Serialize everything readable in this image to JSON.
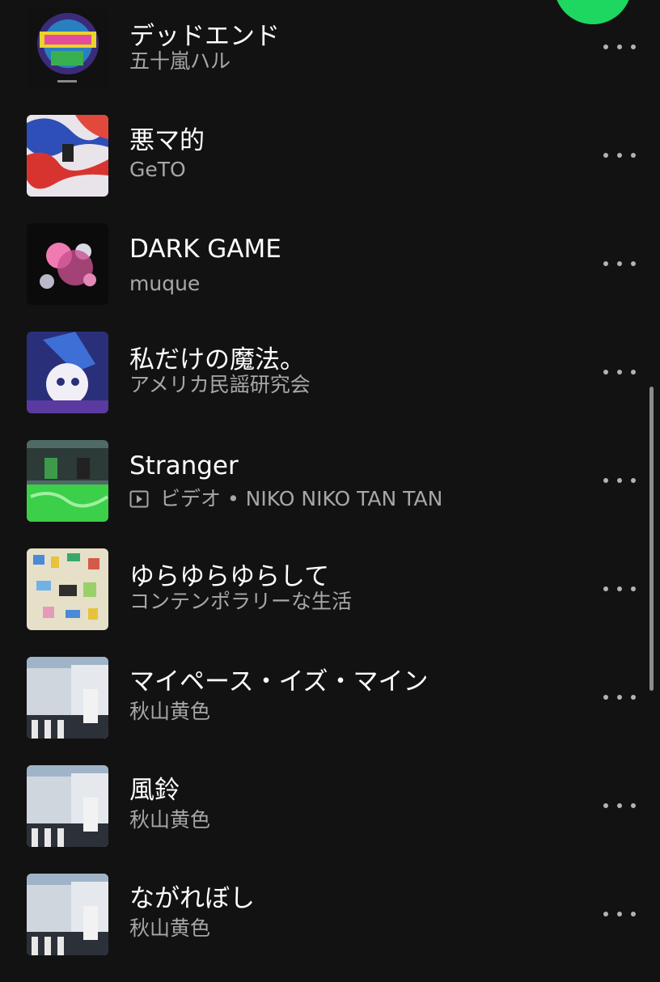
{
  "colors": {
    "background": "#121212",
    "accent": "#1ed760",
    "title": "#ffffff",
    "subtitle": "#a7a7a7"
  },
  "tracks": [
    {
      "title": "デッドエンド",
      "subtitle": "五十嵐ハル"
    },
    {
      "title": "悪マ的",
      "subtitle": "GeTO"
    },
    {
      "title": "DARK GAME",
      "subtitle": "muque"
    },
    {
      "title": "私だけの魔法。",
      "subtitle": "アメリカ民謡研究会"
    },
    {
      "title": "Stranger",
      "subtitle": "ビデオ • NIKO NIKO TAN TAN",
      "type_icon": "video-icon"
    },
    {
      "title": "ゆらゆらゆらして",
      "subtitle": "コンテンポラリーな生活"
    },
    {
      "title": "マイペース・イズ・マイン",
      "subtitle": "秋山黄色"
    },
    {
      "title": "風鈴",
      "subtitle": "秋山黄色"
    },
    {
      "title": "ながれぼし",
      "subtitle": "秋山黄色"
    }
  ],
  "icons": {
    "more": "more-options-icon",
    "video": "video-icon",
    "play": "play-button"
  }
}
